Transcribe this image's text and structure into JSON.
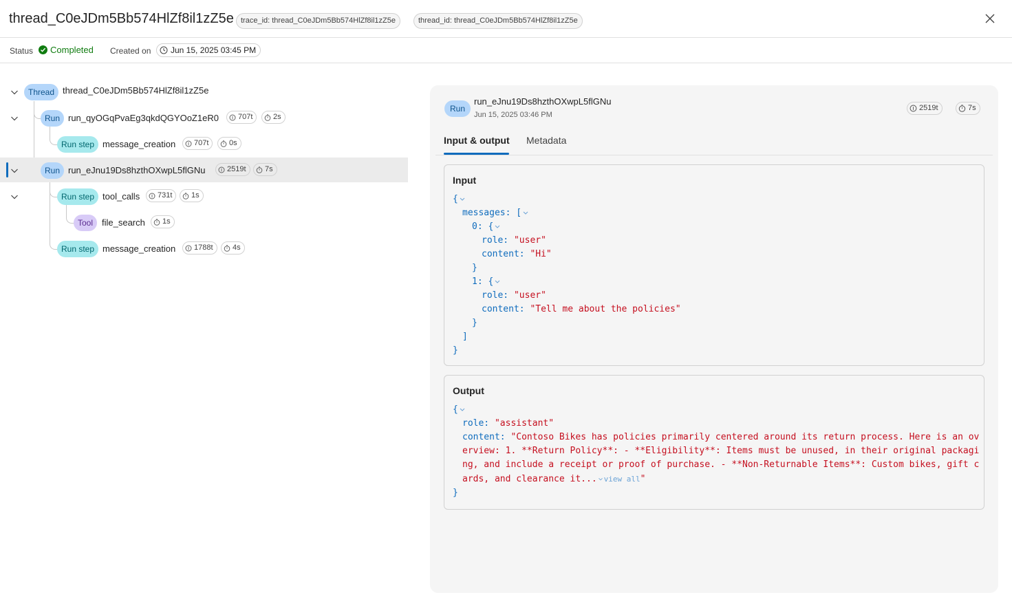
{
  "header": {
    "title": "thread_C0eJDm5Bb574HlZf8il1zZ5e",
    "trace_pill": "trace_id: thread_C0eJDm5Bb574HlZf8il1zZ5e",
    "thread_pill": "thread_id: thread_C0eJDm5Bb574HlZf8il1zZ5e",
    "close_icon": "close-icon"
  },
  "statusbar": {
    "status_label": "Status",
    "status_value": "Completed",
    "created_label": "Created on",
    "created_value": "Jun 15, 2025 03:45 PM",
    "status_color": "#107c10"
  },
  "tree": {
    "nodes": [
      {
        "badge": "Thread",
        "name": "thread_C0eJDm5Bb574HlZf8il1zZ5e",
        "tokens": "",
        "duration": ""
      },
      {
        "badge": "Run",
        "name": "run_qyOGqPvaEg3qkdQGYOoZ1eR0",
        "tokens": "707t",
        "duration": "2s"
      },
      {
        "badge": "Run step",
        "name": "message_creation",
        "tokens": "707t",
        "duration": "0s"
      },
      {
        "badge": "Run",
        "name": "run_eJnu19Ds8hzthOXwpL5flGNu",
        "tokens": "2519t",
        "duration": "7s"
      },
      {
        "badge": "Run step",
        "name": "tool_calls",
        "tokens": "731t",
        "duration": "1s"
      },
      {
        "badge": "Tool",
        "name": "file_search",
        "tokens": "",
        "duration": "1s"
      },
      {
        "badge": "Run step",
        "name": "message_creation",
        "tokens": "1788t",
        "duration": "4s"
      }
    ]
  },
  "detail": {
    "badge": "Run",
    "name": "run_eJnu19Ds8hzthOXwpL5flGNu",
    "date": "Jun 15, 2025 03:46 PM",
    "tokens": "2519t",
    "duration": "7s",
    "tabs": [
      {
        "label": "Input & output"
      },
      {
        "label": "Metadata"
      }
    ],
    "input": {
      "title": "Input",
      "messages_key": "messages:",
      "idx0": "0:",
      "idx1": "1:",
      "role_key": "role:",
      "content_key": "content:",
      "role0": "\"user\"",
      "content0": "\"Hi\"",
      "role1": "\"user\"",
      "content1": "\"Tell me about the policies\""
    },
    "output": {
      "title": "Output",
      "role_key": "role:",
      "content_key": "content:",
      "role": "\"assistant\"",
      "content_line1": "\"Contoso Bikes has policies primarily centered around its return process. Here is an ov",
      "content_line2": "erview: 1. **Return Policy**: - **Eligibility**: Items must be unused, in their original packagi",
      "content_line3": "ng, and include a receipt or proof of purchase. - **Non-Returnable Items**: Custom bikes, gift c",
      "content_line4": "ards, and clearance it...",
      "view_all": "view all",
      "closing_quote": "\""
    },
    "brace_open": "{",
    "brace_close": "}",
    "bracket_open": "[",
    "bracket_close": "]"
  }
}
